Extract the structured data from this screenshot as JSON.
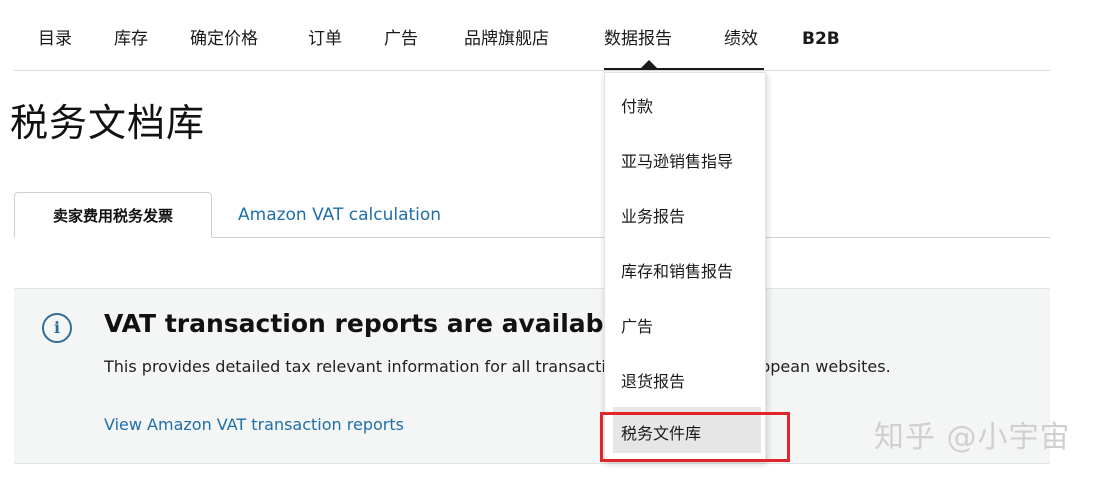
{
  "nav": {
    "items": [
      {
        "label": "目录",
        "bold": false
      },
      {
        "label": "库存",
        "bold": false
      },
      {
        "label": "确定价格",
        "bold": false
      },
      {
        "label": "订单",
        "bold": false
      },
      {
        "label": "广告",
        "bold": false
      },
      {
        "label": "品牌旗舰店",
        "bold": false
      },
      {
        "label": "数据报告",
        "bold": false
      },
      {
        "label": "绩效",
        "bold": false
      },
      {
        "label": "B2B",
        "bold": true
      }
    ]
  },
  "page": {
    "title": "税务文档库"
  },
  "tabs": [
    {
      "label": "卖家费用税务发票",
      "active": true
    },
    {
      "label": "Amazon VAT calculation",
      "active": false
    }
  ],
  "panel": {
    "heading": "VAT transaction reports are available",
    "description": "This provides detailed tax relevant information for all transactions on Amazon European websites.",
    "link": "View Amazon VAT transaction reports"
  },
  "dropdown": {
    "items": [
      {
        "label": "付款"
      },
      {
        "label": "亚马逊销售指导"
      },
      {
        "label": "业务报告"
      },
      {
        "label": "库存和销售报告"
      },
      {
        "label": "广告"
      },
      {
        "label": "退货报告"
      },
      {
        "label": "税务文件库"
      }
    ]
  },
  "watermark": {
    "text": "知乎 @小宇宙"
  },
  "colors": {
    "link": "#1f6fa8",
    "highlight_box": "#e0262b",
    "panel_bg": "#f4f5f5",
    "info_icon": "#2f6f96"
  }
}
